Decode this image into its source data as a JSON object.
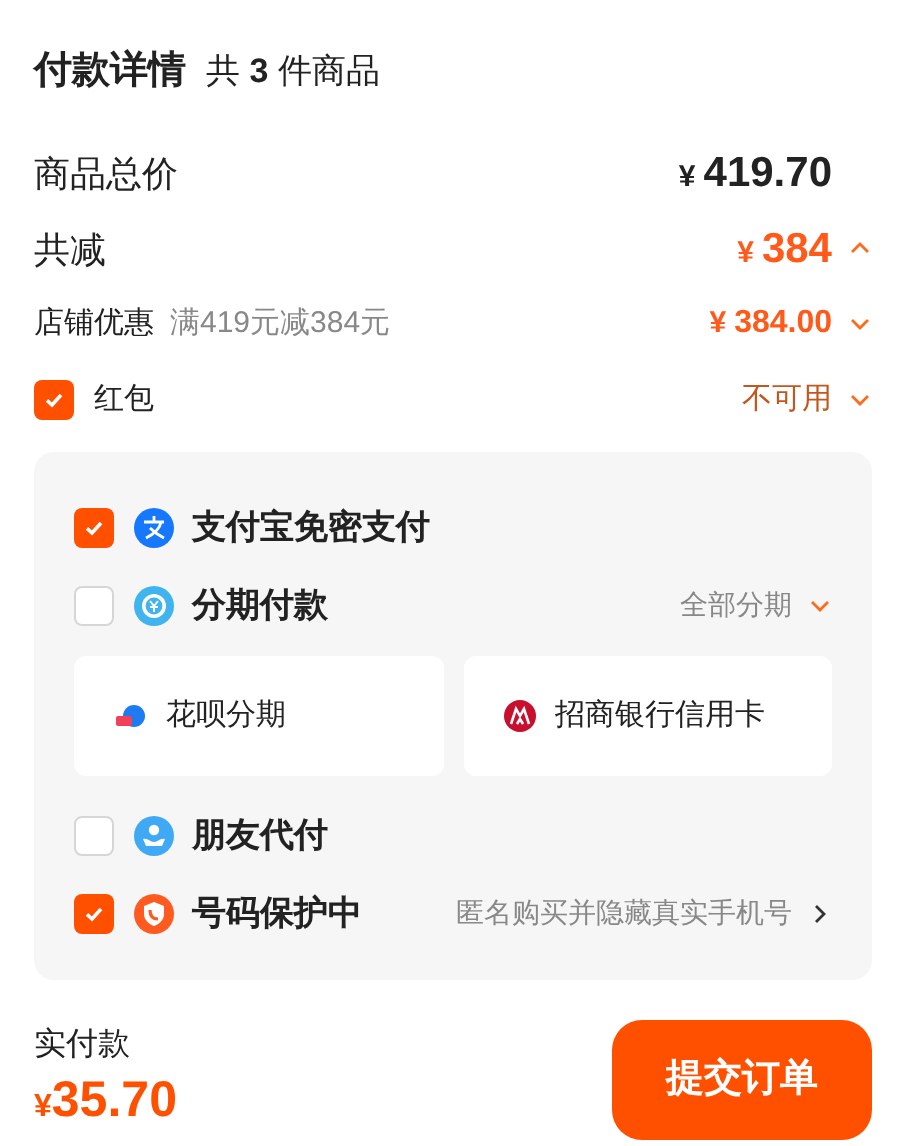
{
  "header": {
    "title": "付款详情",
    "subtitle": "共 **3** 件商品"
  },
  "summary": [
    {
      "kind": "total",
      "label": "商品总价",
      "currency": "¥",
      "amount": "419.70"
    },
    {
      "kind": "discount",
      "label": "共减",
      "currency": "¥",
      "amount": "384",
      "expanded": true
    },
    {
      "kind": "detail",
      "label": "店铺优惠",
      "note": "满419元减384元",
      "currency": "¥",
      "amount": "384.00",
      "expanded": false
    },
    {
      "kind": "checkbox",
      "label": "红包",
      "checked": true,
      "status": "不可用",
      "expanded": false
    }
  ],
  "payment_options": [
    {
      "label": "支付宝免密支付",
      "checked": true
    },
    {
      "label": "分期付款",
      "checked": false,
      "action": {
        "kind": "dropdown",
        "text": "全部分期"
      },
      "choices": [
        {
          "label": "花呗分期"
        },
        {
          "label": "招商银行信用卡"
        }
      ]
    },
    {
      "label": "朋友代付",
      "checked": false
    },
    {
      "label": "号码保护中",
      "checked": true,
      "action": {
        "kind": "link",
        "text": "匿名购买并隐藏真实手机号"
      }
    }
  ],
  "footer": {
    "label": "实付款",
    "currency": "¥",
    "amount": "35.70",
    "submit": "提交订单"
  }
}
